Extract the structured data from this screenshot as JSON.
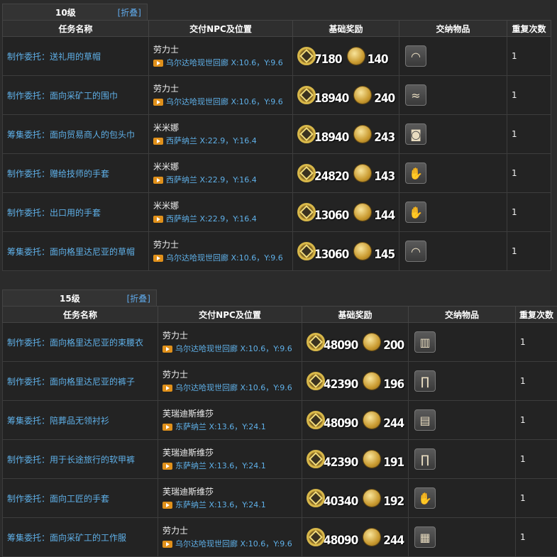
{
  "sections": [
    {
      "title": "10级",
      "fold": "[折叠]",
      "headers": [
        "任务名称",
        "交付NPC及位置",
        "基础奖励",
        "交纳物品",
        "重复次数"
      ],
      "rows": [
        {
          "task": "制作委托：送礼用的草帽",
          "npc": "劳力士",
          "loc": "乌尔达哈现世回廊 X:10.6，Y:9.6",
          "exp": "7180",
          "gil": "140",
          "item_icon": "straw-hat-icon",
          "repeat": "1"
        },
        {
          "task": "制作委托：面向采矿工的围巾",
          "npc": "劳力士",
          "loc": "乌尔达哈现世回廊 X:10.6，Y:9.6",
          "exp": "18940",
          "gil": "240",
          "item_icon": "scarf-icon",
          "repeat": "1"
        },
        {
          "task": "筹集委托：面向贸易商人的包头巾",
          "npc": "米米娜",
          "loc": "西萨纳兰 X:22.9，Y:16.4",
          "exp": "18940",
          "gil": "243",
          "item_icon": "turban-icon",
          "repeat": "1"
        },
        {
          "task": "制作委托：赠给技师的手套",
          "npc": "米米娜",
          "loc": "西萨纳兰 X:22.9，Y:16.4",
          "exp": "24820",
          "gil": "143",
          "item_icon": "gloves-icon",
          "repeat": "1"
        },
        {
          "task": "制作委托：出口用的手套",
          "npc": "米米娜",
          "loc": "西萨纳兰 X:22.9，Y:16.4",
          "exp": "13060",
          "gil": "144",
          "item_icon": "gloves-icon",
          "repeat": "1"
        },
        {
          "task": "筹集委托：面向格里达尼亚的草帽",
          "npc": "劳力士",
          "loc": "乌尔达哈现世回廊 X:10.6，Y:9.6",
          "exp": "13060",
          "gil": "145",
          "item_icon": "straw-hat-icon",
          "repeat": "1"
        }
      ]
    },
    {
      "title": "15级",
      "fold": "[折叠]",
      "headers": [
        "任务名称",
        "交付NPC及位置",
        "基础奖励",
        "交纳物品",
        "重复次数"
      ],
      "rows": [
        {
          "task": "制作委托：面向格里达尼亚的束腰衣",
          "npc": "劳力士",
          "loc": "乌尔达哈现世回廊 X:10.6，Y:9.6",
          "exp": "48090",
          "gil": "200",
          "item_icon": "tunic-icon",
          "repeat": "1"
        },
        {
          "task": "制作委托：面向格里达尼亚的裤子",
          "npc": "劳力士",
          "loc": "乌尔达哈现世回廊 X:10.6，Y:9.6",
          "exp": "42390",
          "gil": "196",
          "item_icon": "trousers-icon",
          "repeat": "1"
        },
        {
          "task": "筹集委托：陪葬品无领衬衫",
          "npc": "芙瑞迪斯维莎",
          "loc": "东萨纳兰 X:13.6，Y:24.1",
          "exp": "48090",
          "gil": "244",
          "item_icon": "shirt-icon",
          "repeat": "1"
        },
        {
          "task": "制作委托：用于长途旅行的软甲裤",
          "npc": "芙瑞迪斯维莎",
          "loc": "东萨纳兰 X:13.6，Y:24.1",
          "exp": "42390",
          "gil": "191",
          "item_icon": "trousers-icon",
          "repeat": "1"
        },
        {
          "task": "制作委托：面向工匠的手套",
          "npc": "芙瑞迪斯维莎",
          "loc": "东萨纳兰 X:13.6，Y:24.1",
          "exp": "40340",
          "gil": "192",
          "item_icon": "gloves-icon",
          "repeat": "1"
        },
        {
          "task": "筹集委托：面向采矿工的工作服",
          "npc": "劳力士",
          "loc": "乌尔达哈现世回廊 X:10.6，Y:9.6",
          "exp": "48090",
          "gil": "244",
          "item_icon": "work-clothes-icon",
          "repeat": "1"
        }
      ]
    }
  ]
}
